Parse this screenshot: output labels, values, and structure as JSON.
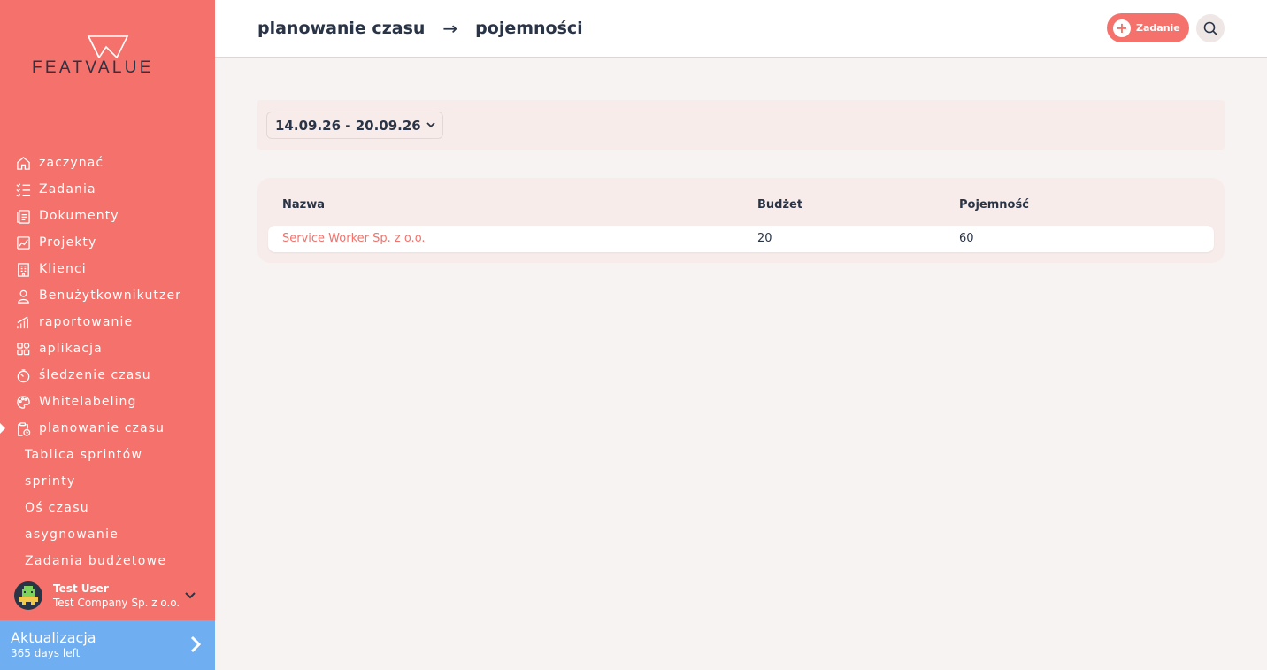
{
  "brand": {
    "name": "FEATVALUE"
  },
  "sidebar": {
    "items": [
      {
        "label": "zaczynać",
        "icon": "home-icon"
      },
      {
        "label": "Zadania",
        "icon": "checklist-icon"
      },
      {
        "label": "Dokumenty",
        "icon": "document-icon"
      },
      {
        "label": "Projekty",
        "icon": "chart-icon"
      },
      {
        "label": "Klienci",
        "icon": "building-icon"
      },
      {
        "label": "Benużytkownikutzer",
        "icon": "user-icon"
      },
      {
        "label": "raportowanie",
        "icon": "bar-chart-icon"
      },
      {
        "label": "aplikacja",
        "icon": "apps-icon"
      },
      {
        "label": "śledzenie czasu",
        "icon": "timer-icon"
      },
      {
        "label": "Whitelabeling",
        "icon": "palette-icon"
      },
      {
        "label": "planowanie czasu",
        "icon": "clipboard-clock-icon",
        "active": true
      }
    ],
    "subitems": [
      {
        "label": "Tablica sprintów"
      },
      {
        "label": "sprinty"
      },
      {
        "label": "Oś czasu"
      },
      {
        "label": "asygnowanie"
      },
      {
        "label": "Zadania budżetowe"
      }
    ]
  },
  "user": {
    "name": "Test User",
    "company": "Test Company Sp. z o.o."
  },
  "upgrade": {
    "title": "Aktualizacja",
    "subtitle": "365 days left"
  },
  "header": {
    "breadcrumb": [
      "planowanie czasu",
      "pojemności"
    ],
    "separator": "→",
    "add_button_label": "Zadanie"
  },
  "filter": {
    "date_range": "14.09.26 - 20.09.26"
  },
  "table": {
    "columns": [
      "Nazwa",
      "Budżet",
      "Pojemność"
    ],
    "rows": [
      {
        "name": "Service Worker Sp. z o.o.",
        "budget": "20",
        "capacity": "60"
      }
    ]
  },
  "colors": {
    "accent": "#f4726b",
    "sidebar": "#f4726b",
    "upgrade": "#6eaef1",
    "text": "#2a3447"
  }
}
